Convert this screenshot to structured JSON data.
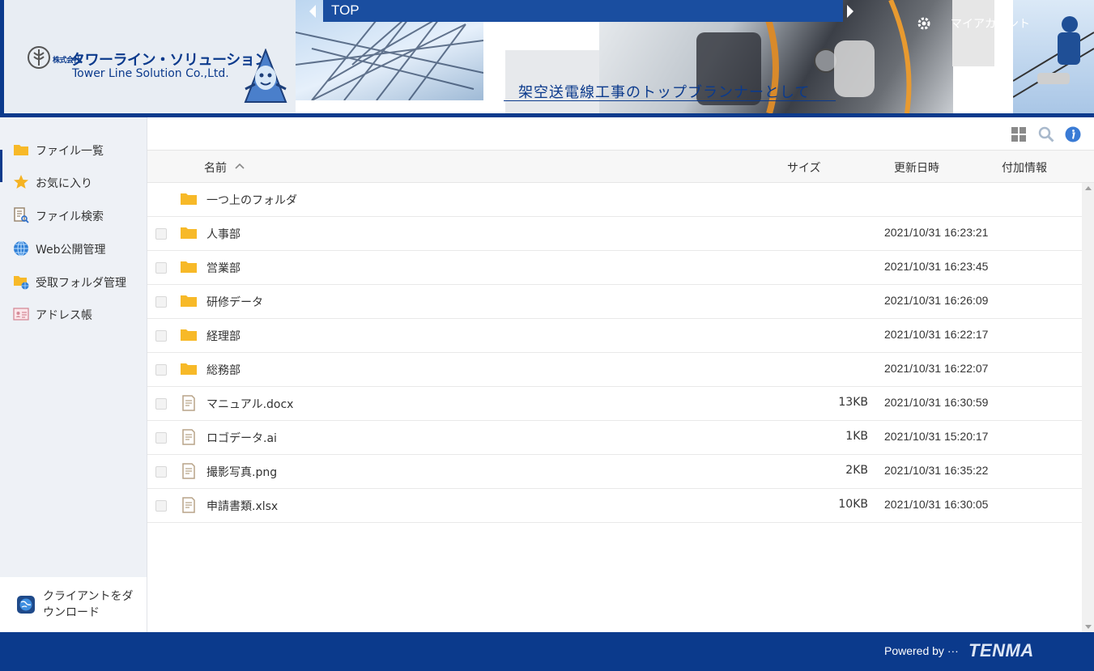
{
  "header": {
    "company_jp_prefix": "株式会社",
    "company_jp": "タワーライン・ソリューション",
    "company_en": "Tower Line Solution Co.,Ltd.",
    "tagline": "架空送電線工事のトップブランナーとして",
    "breadcrumb": "TOP",
    "account_label": "マイアカウント"
  },
  "sidebar": {
    "items": [
      {
        "label": "ファイル一覧",
        "icon": "folder-icon"
      },
      {
        "label": "お気に入り",
        "icon": "star-icon"
      },
      {
        "label": "ファイル検索",
        "icon": "file-search-icon"
      },
      {
        "label": "Web公開管理",
        "icon": "globe-icon"
      },
      {
        "label": "受取フォルダ管理",
        "icon": "folder-globe-icon"
      },
      {
        "label": "アドレス帳",
        "icon": "address-card-icon"
      }
    ],
    "client_download": "クライアントをダウンロード"
  },
  "columns": {
    "name": "名前",
    "size": "サイズ",
    "date": "更新日時",
    "extra": "付加情報"
  },
  "files": [
    {
      "name": "一つ上のフォルダ",
      "type": "folder",
      "size": "",
      "date": ""
    },
    {
      "name": "人事部",
      "type": "folder",
      "size": "",
      "date": "2021/10/31 16:23:21"
    },
    {
      "name": "営業部",
      "type": "folder",
      "size": "",
      "date": "2021/10/31 16:23:45"
    },
    {
      "name": "研修データ",
      "type": "folder",
      "size": "",
      "date": "2021/10/31 16:26:09"
    },
    {
      "name": "経理部",
      "type": "folder",
      "size": "",
      "date": "2021/10/31 16:22:17"
    },
    {
      "name": "総務部",
      "type": "folder",
      "size": "",
      "date": "2021/10/31 16:22:07"
    },
    {
      "name": "マニュアル.docx",
      "type": "file",
      "size": "13KB",
      "date": "2021/10/31 16:30:59"
    },
    {
      "name": "ロゴデータ.ai",
      "type": "file",
      "size": "1KB",
      "date": "2021/10/31 15:20:17"
    },
    {
      "name": "撮影写真.png",
      "type": "file",
      "size": "2KB",
      "date": "2021/10/31 16:35:22"
    },
    {
      "name": "申請書類.xlsx",
      "type": "file",
      "size": "10KB",
      "date": "2021/10/31 16:30:05"
    }
  ],
  "footer": {
    "powered_by": "Powered by ···",
    "brand": "TENMA"
  },
  "colors": {
    "brand_blue": "#0b3a8c",
    "folder_yellow": "#f7b928",
    "sidebar_bg": "#eef1f6"
  }
}
